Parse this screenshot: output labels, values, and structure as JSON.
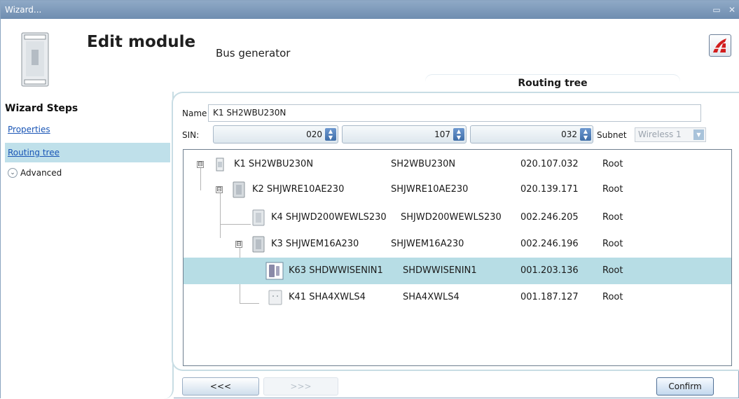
{
  "window": {
    "title": "Wizard...",
    "minimize": "▭",
    "close": "✕"
  },
  "header": {
    "title": "Edit module",
    "subtitle": "Bus generator",
    "active_tab": "Routing tree"
  },
  "sidebar": {
    "title": "Wizard Steps",
    "items": [
      {
        "label": "Properties"
      },
      {
        "label": "Routing tree"
      },
      {
        "label": "Advanced"
      }
    ]
  },
  "form": {
    "name_label": "Name",
    "name_value": "K1 SH2WBU230N",
    "sin_label": "SIN:",
    "sin_parts": [
      "020",
      "107",
      "032"
    ],
    "subnet_label": "Subnet",
    "subnet_value": "Wireless 1"
  },
  "tree": {
    "rows": [
      {
        "name": "K1 SH2WBU230N",
        "model": "SH2WBU230N",
        "sin": "020.107.032",
        "route": "Root",
        "expander": "⊟"
      },
      {
        "name": "K2 SHJWRE10AE230",
        "model": "SHJWRE10AE230",
        "sin": "020.139.171",
        "route": "Root",
        "expander": "⊟"
      },
      {
        "name": "K4 SHJWD200WEWLS230",
        "model": "SHJWD200WEWLS230",
        "sin": "002.246.205",
        "route": "Root",
        "expander": ""
      },
      {
        "name": "K3 SHJWEM16A230",
        "model": "SHJWEM16A230",
        "sin": "002.246.196",
        "route": "Root",
        "expander": "⊟"
      },
      {
        "name": "K63 SHDWWISENIN1",
        "model": "SHDWWISENIN1",
        "sin": "001.203.136",
        "route": "Root",
        "expander": ""
      },
      {
        "name": "K41 SHA4XWLS4",
        "model": "SHA4XWLS4",
        "sin": "001.187.127",
        "route": "Root",
        "expander": ""
      }
    ]
  },
  "footer": {
    "back": "<<<",
    "next": ">>>",
    "confirm": "Confirm"
  }
}
